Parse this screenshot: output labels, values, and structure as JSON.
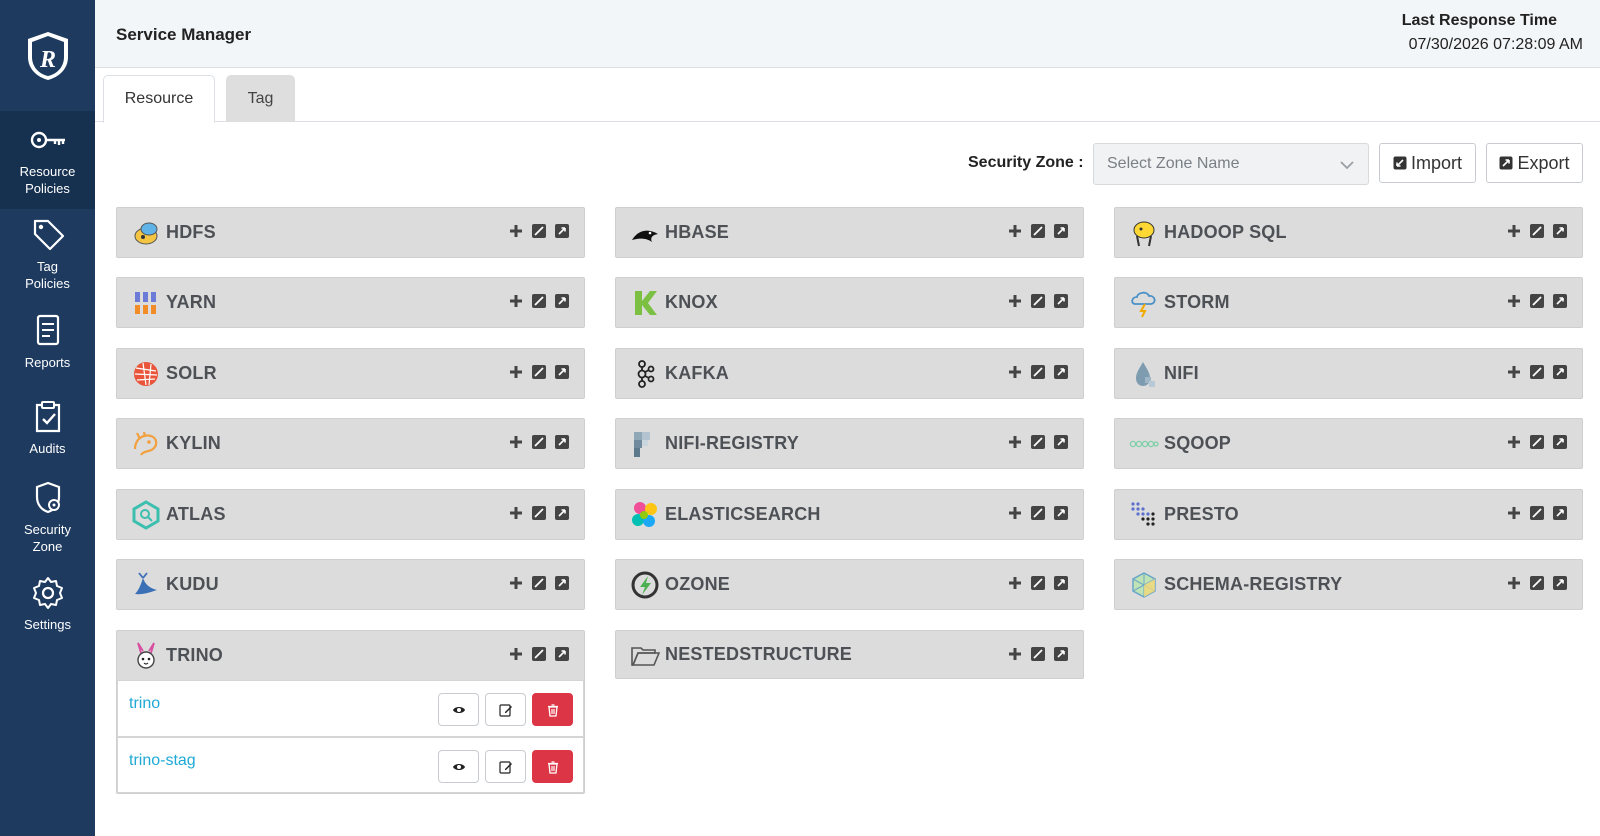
{
  "sidebar": {
    "items": [
      {
        "label": "Resource\nPolicies",
        "icon": "key-icon",
        "active": true
      },
      {
        "label": "Tag\nPolicies",
        "icon": "tag-icon"
      },
      {
        "label": "Reports",
        "icon": "report-icon"
      },
      {
        "label": "Audits",
        "icon": "clipboard-check-icon"
      },
      {
        "label": "Security\nZone",
        "icon": "shield-lock-icon"
      },
      {
        "label": "Settings",
        "icon": "gear-icon"
      }
    ]
  },
  "header": {
    "title": "Service Manager",
    "response_label": "Last Response Time",
    "response_value": "07/30/2026 07:28:09 AM"
  },
  "tabs": [
    {
      "label": "Resource",
      "active": true
    },
    {
      "label": "Tag",
      "active": false
    }
  ],
  "toolbar": {
    "zone_label": "Security Zone :",
    "zone_placeholder": "Select Zone Name",
    "import_label": "Import",
    "export_label": "Export"
  },
  "services": [
    {
      "name": "HDFS",
      "icon": "hdfs-icon"
    },
    {
      "name": "HBASE",
      "icon": "hbase-icon"
    },
    {
      "name": "HADOOP SQL",
      "icon": "hadoop-sql-icon"
    },
    {
      "name": "YARN",
      "icon": "yarn-icon"
    },
    {
      "name": "KNOX",
      "icon": "knox-icon"
    },
    {
      "name": "STORM",
      "icon": "storm-icon"
    },
    {
      "name": "SOLR",
      "icon": "solr-icon"
    },
    {
      "name": "KAFKA",
      "icon": "kafka-icon"
    },
    {
      "name": "NIFI",
      "icon": "nifi-icon"
    },
    {
      "name": "KYLIN",
      "icon": "kylin-icon"
    },
    {
      "name": "NIFI-REGISTRY",
      "icon": "nifi-registry-icon"
    },
    {
      "name": "SQOOP",
      "icon": "sqoop-icon"
    },
    {
      "name": "ATLAS",
      "icon": "atlas-icon"
    },
    {
      "name": "ELASTICSEARCH",
      "icon": "elasticsearch-icon"
    },
    {
      "name": "PRESTO",
      "icon": "presto-icon"
    },
    {
      "name": "KUDU",
      "icon": "kudu-icon"
    },
    {
      "name": "OZONE",
      "icon": "ozone-icon"
    },
    {
      "name": "SCHEMA-REGISTRY",
      "icon": "schema-registry-icon"
    },
    {
      "name": "TRINO",
      "icon": "trino-icon",
      "instances": [
        "trino",
        "trino-stag"
      ]
    },
    {
      "name": "NESTEDSTRUCTURE",
      "icon": "folder-icon"
    }
  ]
}
